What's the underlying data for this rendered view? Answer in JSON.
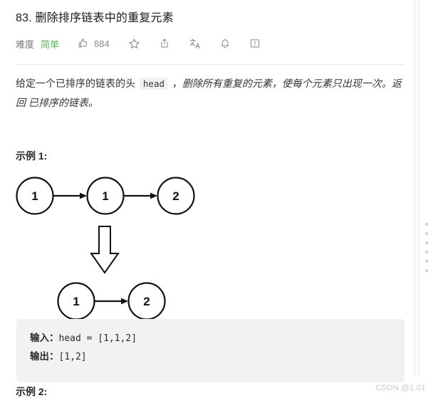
{
  "header": {
    "title": "83. 删除排序链表中的重复元素",
    "difficulty_label": "难度",
    "difficulty_value": "简单",
    "difficulty_color": "#5cb85c",
    "vote_count": "884",
    "actions": [
      {
        "name": "thumbs-up-icon",
        "label": "884"
      },
      {
        "name": "star-icon",
        "label": "收藏"
      },
      {
        "name": "share-icon",
        "label": "分享"
      },
      {
        "name": "translate-icon",
        "label": "切换语言"
      },
      {
        "name": "bell-icon",
        "label": "订阅"
      },
      {
        "name": "feedback-icon",
        "label": "反馈"
      }
    ]
  },
  "description": {
    "part1": "给定一个已排序的链表的头 ",
    "code": "head",
    "part2": " ，",
    "emphasis": "删除所有重复的元素，使每个元素只出现一次。返回 已排序的链表。"
  },
  "examples": {
    "example1_heading": "示例 1:",
    "example2_heading": "示例 2:",
    "code_block": {
      "input_key": "输入：",
      "input_value": "head = [1,1,2]",
      "output_key": "输出：",
      "output_value": "[1,2]"
    }
  },
  "figures": {
    "before": {
      "caption": "输入链表 1 -> 1 -> 2",
      "nodes": [
        "1",
        "1",
        "2"
      ]
    },
    "transform": {
      "caption": "转换为"
    },
    "after": {
      "caption": "输出链表 1 -> 2",
      "nodes": [
        "1",
        "2"
      ]
    }
  },
  "watermark": "CSDN @1.01",
  "right_rail": {
    "dot_count": 6
  }
}
